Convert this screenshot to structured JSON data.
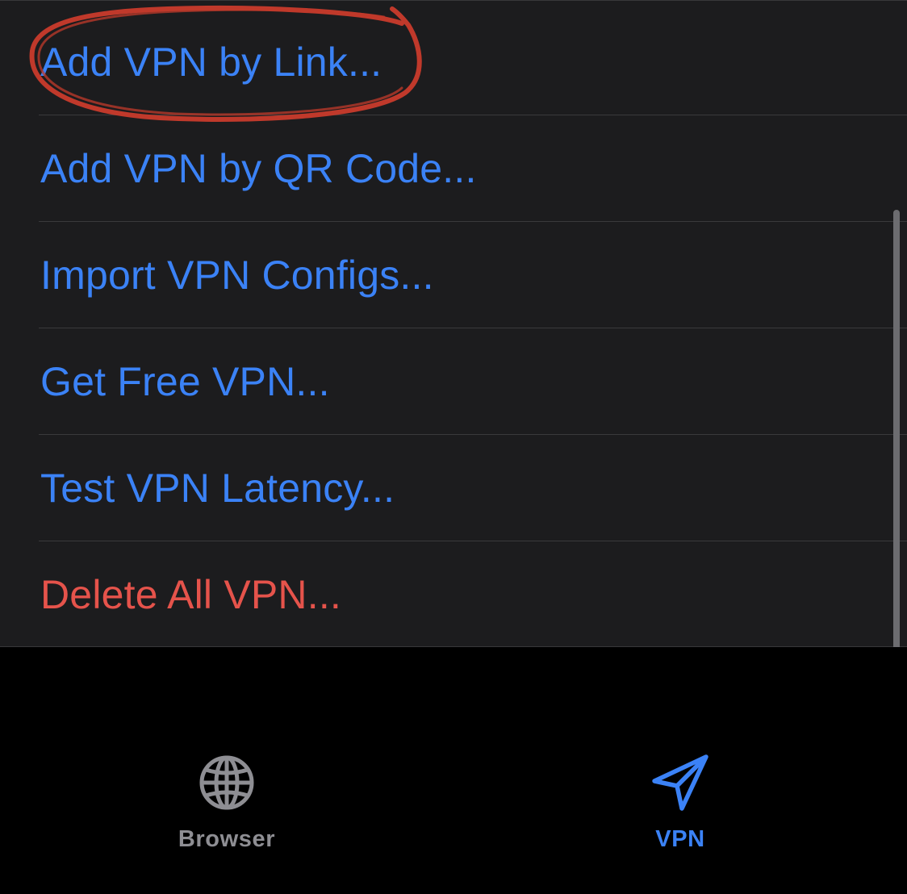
{
  "menu": {
    "items": [
      {
        "label": "Add VPN by Link..."
      },
      {
        "label": "Add VPN by QR Code..."
      },
      {
        "label": "Import VPN Configs..."
      },
      {
        "label": "Get Free VPN..."
      },
      {
        "label": "Test VPN Latency..."
      },
      {
        "label": "Delete All VPN..."
      }
    ]
  },
  "tabbar": {
    "tabs": [
      {
        "label": "Browser",
        "icon": "globe-icon",
        "selected": false
      },
      {
        "label": "VPN",
        "icon": "paper-plane-icon",
        "selected": true
      }
    ]
  },
  "colors": {
    "accent": "#3b82f6",
    "destructive": "#e5534b",
    "annotation": "#c0392b",
    "inactive_tab": "#8e8e93",
    "group_background": "#1c1c1e",
    "screen_background": "#000000"
  }
}
